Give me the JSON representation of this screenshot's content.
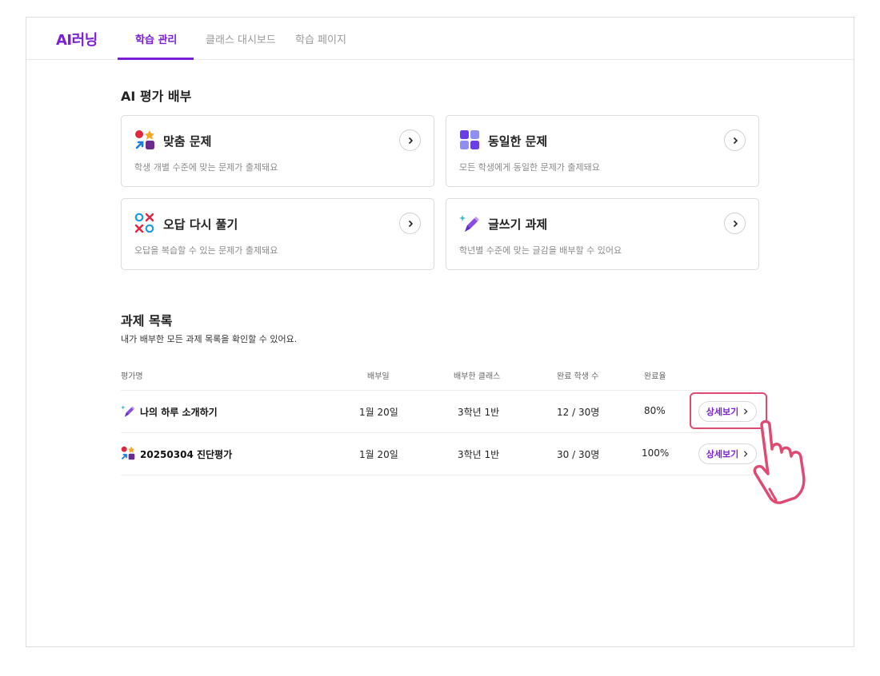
{
  "header": {
    "logo": "AI러닝",
    "tabs": [
      {
        "label": "학습 관리",
        "active": true
      },
      {
        "label": "클래스 대시보드",
        "active": false
      },
      {
        "label": "학습 페이지",
        "active": false
      }
    ]
  },
  "ai_section": {
    "title": "AI 평가 배부",
    "cards": [
      {
        "icon": "shapes-icon",
        "title": "맞춤 문제",
        "desc": "학생 개별 수준에 맞는 문제가 출제돼요"
      },
      {
        "icon": "grid-icon",
        "title": "동일한 문제",
        "desc": "모든 학생에게 동일한 문제가 출제돼요"
      },
      {
        "icon": "ox-icon",
        "title": "오답 다시 풀기",
        "desc": "오답을 복습할 수 있는 문제가 출제돼요"
      },
      {
        "icon": "pen-icon",
        "title": "글쓰기 과제",
        "desc": "학년별 수준에 맞는 글감을 배부할 수 있어요"
      }
    ]
  },
  "task_section": {
    "title": "과제 목록",
    "subtitle": "내가 배부한 모든 과제 목록을 확인할 수 있어요.",
    "columns": [
      "평가명",
      "배부일",
      "배부한 클래스",
      "완료 학생 수",
      "완료율"
    ],
    "rows": [
      {
        "icon": "pen-icon",
        "name": "나의 하루 소개하기",
        "date": "1월 20일",
        "class": "3학년 1반",
        "done": "12 / 30명",
        "rate": "80%",
        "button": "상세보기"
      },
      {
        "icon": "shapes-icon",
        "name": "20250304 진단평가",
        "date": "1월 20일",
        "class": "3학년 1반",
        "done": "30 / 30명",
        "rate": "100%",
        "button": "상세보기"
      }
    ]
  },
  "colors": {
    "accent": "#7a1fd6",
    "highlight": "#e04a72"
  }
}
